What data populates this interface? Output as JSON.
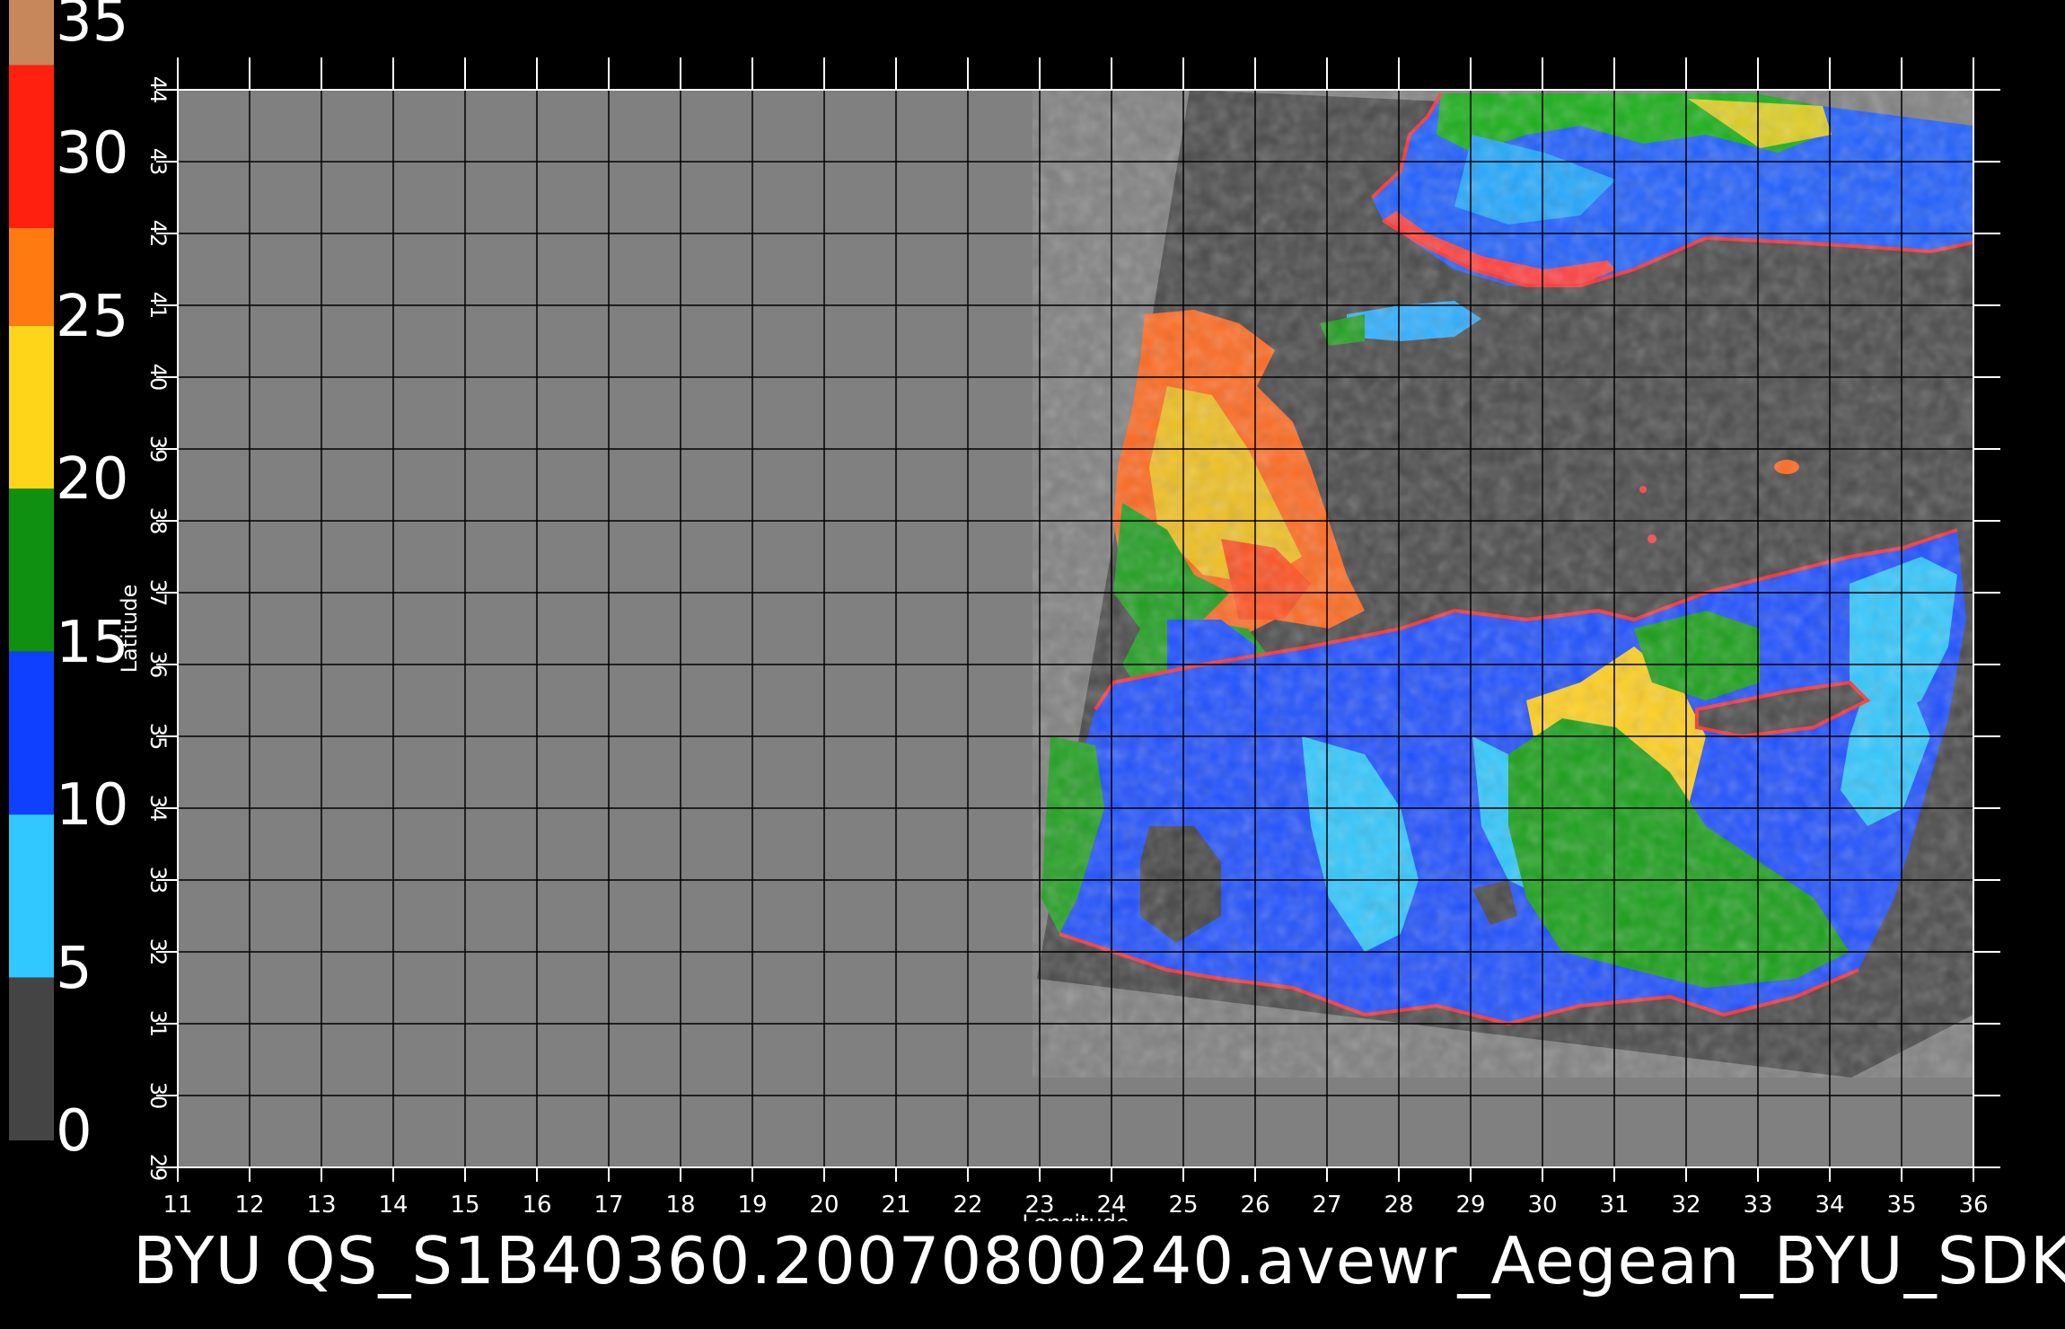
{
  "colorbar": {
    "ticks": [
      "35",
      "30",
      "25",
      "20",
      "15",
      "10",
      "5",
      "0"
    ],
    "segments": [
      {
        "range": [
          33,
          35
        ],
        "color": "#c8875a"
      },
      {
        "range": [
          28,
          33
        ],
        "color": "#ff2010"
      },
      {
        "range": [
          25,
          28
        ],
        "color": "#ff7a10"
      },
      {
        "range": [
          20,
          25
        ],
        "color": "#ffd51a"
      },
      {
        "range": [
          15,
          20
        ],
        "color": "#109010"
      },
      {
        "range": [
          10,
          15
        ],
        "color": "#1040ff"
      },
      {
        "range": [
          5,
          10
        ],
        "color": "#30c8ff"
      },
      {
        "range": [
          0,
          5
        ],
        "color": "#444444"
      }
    ]
  },
  "map": {
    "lon_ticks": [
      "11",
      "12",
      "13",
      "14",
      "15",
      "16",
      "17",
      "18",
      "19",
      "20",
      "21",
      "22",
      "23",
      "24",
      "25",
      "26",
      "27",
      "28",
      "29",
      "30",
      "31",
      "32",
      "33",
      "34",
      "35",
      "36"
    ],
    "lat_ticks": [
      "29",
      "30",
      "31",
      "32",
      "33",
      "34",
      "35",
      "36",
      "37",
      "38",
      "39",
      "40",
      "41",
      "42",
      "43",
      "44"
    ],
    "xlabel": "Longitude",
    "ylabel": "Latitude",
    "lon_range": [
      11,
      36
    ],
    "lat_range": [
      29,
      44
    ],
    "background_color": "#808080",
    "swath_color": "#4a4a4a",
    "grid": true
  },
  "footer": {
    "title": "BYU  QS_S1B40360.20070800240.avewr_Aegean_BYU_SDK"
  }
}
